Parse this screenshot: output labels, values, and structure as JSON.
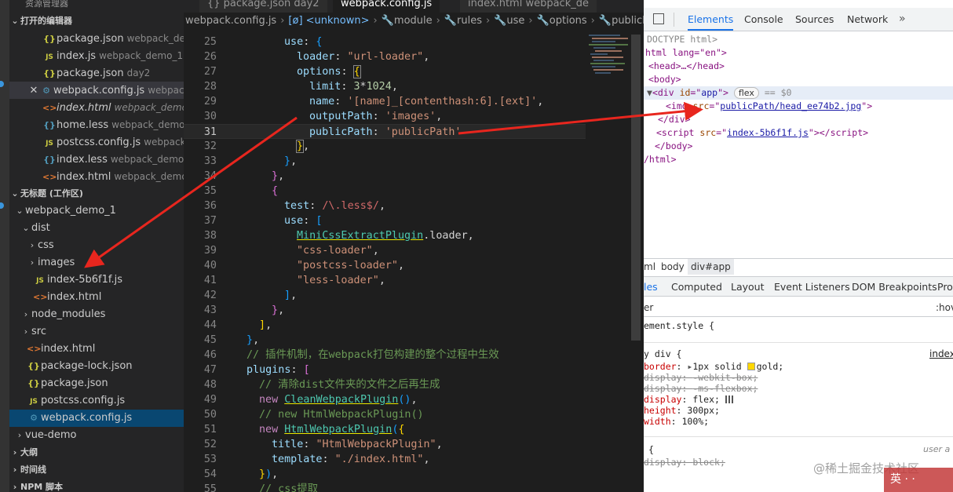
{
  "sidebar": {
    "top_label": "资源管理器",
    "open_editors_title": "打开的编辑器",
    "open_editors": [
      {
        "name": "package.json",
        "desc": "webpack_de...",
        "icon": "json-icon"
      },
      {
        "name": "index.js",
        "desc": "webpack_demo_1 ...",
        "icon": "js-icon"
      },
      {
        "name": "package.json",
        "desc": "day2",
        "icon": "json-icon"
      },
      {
        "name": "webpack.config.js",
        "desc": "webpac...",
        "icon": "gear-icon"
      },
      {
        "name": "index.html",
        "desc": "webpack_demo...",
        "icon": "html-icon"
      },
      {
        "name": "home.less",
        "desc": "webpack_demo...",
        "icon": "less-icon"
      },
      {
        "name": "postcss.config.js",
        "desc": "webpack...",
        "icon": "js-icon"
      },
      {
        "name": "index.less",
        "desc": "webpack_demo_...",
        "icon": "less-icon"
      },
      {
        "name": "index.html",
        "desc": "webpack_demo...",
        "icon": "html-icon"
      }
    ],
    "workspace_title": "无标题 (工作区)",
    "tree": [
      {
        "name": "webpack_demo_1",
        "type": "folder-open"
      },
      {
        "name": "dist",
        "type": "folder-open"
      },
      {
        "name": "css",
        "type": "folder"
      },
      {
        "name": "images",
        "type": "folder"
      },
      {
        "name": "index-5b6f1f.js",
        "type": "js"
      },
      {
        "name": "index.html",
        "type": "html"
      },
      {
        "name": "node_modules",
        "type": "folder"
      },
      {
        "name": "src",
        "type": "folder"
      },
      {
        "name": "index.html",
        "type": "html"
      },
      {
        "name": "package-lock.json",
        "type": "json"
      },
      {
        "name": "package.json",
        "type": "json"
      },
      {
        "name": "postcss.config.js",
        "type": "js"
      },
      {
        "name": "webpack.config.js",
        "type": "gear"
      },
      {
        "name": "vue-demo",
        "type": "folder"
      }
    ],
    "outline_title": "大纲",
    "timeline_title": "时间线",
    "npm_title": "NPM 脚本"
  },
  "editor": {
    "tabs": [
      {
        "label": "{} package.json day2"
      },
      {
        "label": "webpack.config.js"
      },
      {
        "label": "index.html webpack_de"
      }
    ],
    "breadcrumb": [
      "webpack.config.js",
      "[ø] <unknown>",
      "module",
      "rules",
      "use",
      "options",
      "publicPath"
    ],
    "line_numbers": [
      "25",
      "26",
      "27",
      "28",
      "29",
      "30",
      "31",
      "32",
      "33",
      "34",
      "35",
      "36",
      "37",
      "38",
      "39",
      "40",
      "41",
      "42",
      "43",
      "44",
      "45",
      "46",
      "47",
      "48",
      "49",
      "50",
      "51",
      "52",
      "53",
      "54",
      "55"
    ],
    "current_line": "31",
    "code": {
      "l26": {
        "key": "loader",
        "val": "\"url-loader\""
      },
      "l27": {
        "key": "options"
      },
      "l28": {
        "key": "limit",
        "num1": "3",
        "op": "*",
        "num2": "1024"
      },
      "l29": {
        "key": "name",
        "val": "'[name]_[contenthash:6].[ext]'"
      },
      "l30": {
        "key": "outputPath",
        "val": "'images'"
      },
      "l31": {
        "key": "publicPath",
        "val": "'publicPath'"
      },
      "l36": {
        "key": "test",
        "regex": "/\\.less$/"
      },
      "l37": {
        "key": "use"
      },
      "l38": {
        "cls": "MiniCssExtractPlugin",
        "rest": ".loader,"
      },
      "l39": {
        "val": "\"css-loader\""
      },
      "l40": {
        "val": "\"postcss-loader\""
      },
      "l41": {
        "val": "\"less-loader\""
      },
      "l46": {
        "comment": "// 插件机制，在webpack打包构建的整个过程中生效"
      },
      "l47": {
        "key": "plugins"
      },
      "l48": {
        "comment": "// 清除dist文件夹的文件之后再生成"
      },
      "l49": {
        "kw": "new",
        "cls": "CleanWebpackPlugin"
      },
      "l50": {
        "comment": "// new HtmlWebpackPlugin()"
      },
      "l51": {
        "kw": "new",
        "cls": "HtmlWebpackPlugin"
      },
      "l52": {
        "key": "title",
        "val": "\"HtmlWebpackPlugin\""
      },
      "l53": {
        "key": "template",
        "val": "\"./index.html\""
      },
      "l55": {
        "comment": "// css提取"
      }
    }
  },
  "devtools": {
    "tabs": [
      "Elements",
      "Console",
      "Sources",
      "Network"
    ],
    "more": "»",
    "dom": {
      "doctype": "DOCTYPE html>",
      "html_open": "html lang=\"en\">",
      "head": "<head>…</head>",
      "body_open": "<body>",
      "div_id": "app",
      "flex_badge": "flex",
      "eq0": "== $0",
      "img_src": "publicPath/head_ee74b2.jpg",
      "div_close": "</div>",
      "script_src": "index-5b6f1f.js",
      "body_close": "</body>",
      "html_close": "/html>"
    },
    "crumbs": [
      "ml",
      "body",
      "div#app"
    ],
    "style_tabs": [
      "les",
      "Computed",
      "Layout",
      "Event Listeners",
      "DOM Breakpoints",
      "Pro"
    ],
    "filter_text": "er",
    "hov_label": ":hov",
    "styles": {
      "element_style": "ement.style {",
      "rule_selector": "y div {",
      "rule_source": "index",
      "border": "1px solid",
      "border_color": "gold",
      "display1": "-webkit-box;",
      "display2": "-ms-flexbox;",
      "display3": "flex;",
      "height": "300px;",
      "width": "100%;",
      "ua_selector": "{",
      "ua_label": "user a",
      "ua_display": "block;"
    },
    "watermark": "@稀土掘金技术社区",
    "ime_text": "英 · ·"
  }
}
